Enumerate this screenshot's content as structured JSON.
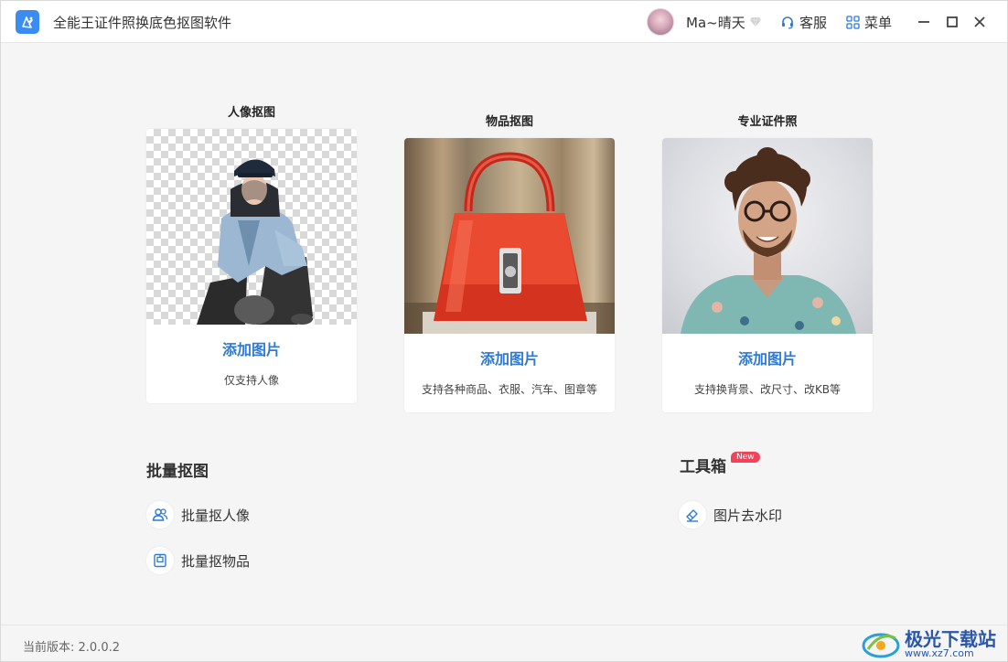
{
  "app": {
    "title": "全能王证件照换底色抠图软件",
    "brand_color": "#3b8cf0"
  },
  "header": {
    "username": "Ma~晴天",
    "service_label": "客服",
    "menu_label": "菜单"
  },
  "cards": [
    {
      "title": "人像抠图",
      "add_label": "添加图片",
      "desc": "仅支持人像"
    },
    {
      "title": "物品抠图",
      "add_label": "添加图片",
      "desc": "支持各种商品、衣服、汽车、图章等"
    },
    {
      "title": "专业证件照",
      "add_label": "添加图片",
      "desc": "支持换背景、改尺寸、改KB等"
    }
  ],
  "batch": {
    "title": "批量抠图",
    "items": [
      {
        "label": "批量抠人像",
        "icon": "users-icon"
      },
      {
        "label": "批量抠物品",
        "icon": "box-icon"
      }
    ]
  },
  "toolbox": {
    "title": "工具箱",
    "badge": "New",
    "items": [
      {
        "label": "图片去水印",
        "icon": "eraser-icon"
      }
    ]
  },
  "footer": {
    "version": "当前版本: 2.0.0.2",
    "watermark_text": "极光下载站",
    "watermark_url": "www.xz7.com"
  },
  "colors": {
    "accent": "#2e7ad6",
    "badge": "#f0445b",
    "background": "#f5f5f5"
  }
}
